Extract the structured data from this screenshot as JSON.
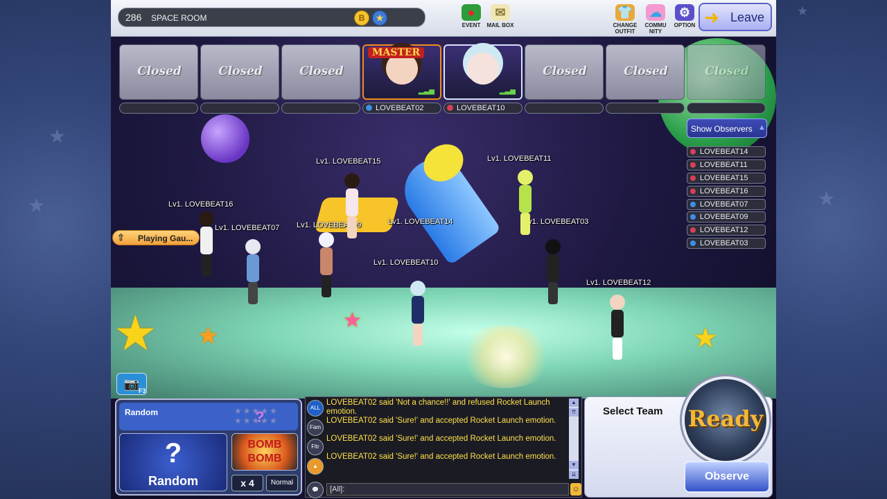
{
  "room": {
    "number": "286",
    "name": "SPACE ROOM",
    "coin_b": "B",
    "coin_star": "★"
  },
  "top_icons": [
    {
      "label": "EVENT",
      "icon": "strawberry-event-icon"
    },
    {
      "label": "MAIL BOX",
      "icon": "envelope-mailbox-icon"
    },
    {
      "label": "CHANGE OUTFIT",
      "icon": "outfit-icon"
    },
    {
      "label": "COMMU NITY",
      "icon": "community-icon"
    },
    {
      "label": "OPTION",
      "icon": "gear-icon"
    }
  ],
  "leave_label": "Leave",
  "slots": [
    {
      "state": "Closed",
      "name": ""
    },
    {
      "state": "Closed",
      "name": ""
    },
    {
      "state": "Closed",
      "name": ""
    },
    {
      "state": "player",
      "name": "LOVEBEAT02",
      "tag": "MASTER",
      "team": "blue"
    },
    {
      "state": "player",
      "name": "LOVEBEAT10",
      "tag": "",
      "team": "red"
    },
    {
      "state": "Closed",
      "name": ""
    },
    {
      "state": "Closed",
      "name": ""
    },
    {
      "state": "Closed",
      "name": ""
    }
  ],
  "observers_button": "Show Observers",
  "observers": [
    {
      "name": "LOVEBEAT14",
      "team": "red"
    },
    {
      "name": "LOVEBEAT11",
      "team": "red"
    },
    {
      "name": "LOVEBEAT15",
      "team": "red"
    },
    {
      "name": "LOVEBEAT16",
      "team": "red"
    },
    {
      "name": "LOVEBEAT07",
      "team": "blue"
    },
    {
      "name": "LOVEBEAT09",
      "team": "blue"
    },
    {
      "name": "LOVEBEAT12",
      "team": "red"
    },
    {
      "name": "LOVEBEAT03",
      "team": "blue"
    }
  ],
  "scene_names": {
    "n15": "Lv1. LOVEBEAT15",
    "n11": "Lv1. LOVEBEAT11",
    "n16": "Lv1. LOVEBEAT16",
    "n07": "Lv1. LOVEBEAT07",
    "n09": "Lv1. LOVEBEAT09",
    "n14": "Lv1. LOVEBEAT14",
    "n03": "Lv1. LOVEBEAT03",
    "n10": "Lv1. LOVEBEAT10",
    "n12": "Lv1. LOVEBEAT12"
  },
  "playing_button": "Playing Gau...",
  "camera_key": "F3",
  "mode": {
    "song_title": "Random",
    "stars": "★★★★★",
    "random_q": "?",
    "random_label": "Random",
    "bomb_label": "BOMB BOMB",
    "speed": "x 4",
    "difficulty": "Normal"
  },
  "chat": {
    "tabs": [
      "ALL",
      "Fam",
      "Fltr",
      "▲"
    ],
    "lines": [
      "LOVEBEAT02 said 'Not a chance!!' and refused Rocket Launch emotion.",
      "LOVEBEAT02 said 'Sure!' and accepted Rocket Launch emotion.",
      "LOVEBEAT02 said 'Sure!' and accepted Rocket Launch emotion.",
      "LOVEBEAT02 said 'Sure!' and accepted Rocket Launch emotion."
    ],
    "input_prefix": "[All]:"
  },
  "team": {
    "title": "Select Team",
    "ready": "Ready",
    "observe": "Observe"
  },
  "colors": {
    "team_red": "#d6405a",
    "team_blue": "#3e8fe6",
    "chat_text": "#ffe14a"
  }
}
